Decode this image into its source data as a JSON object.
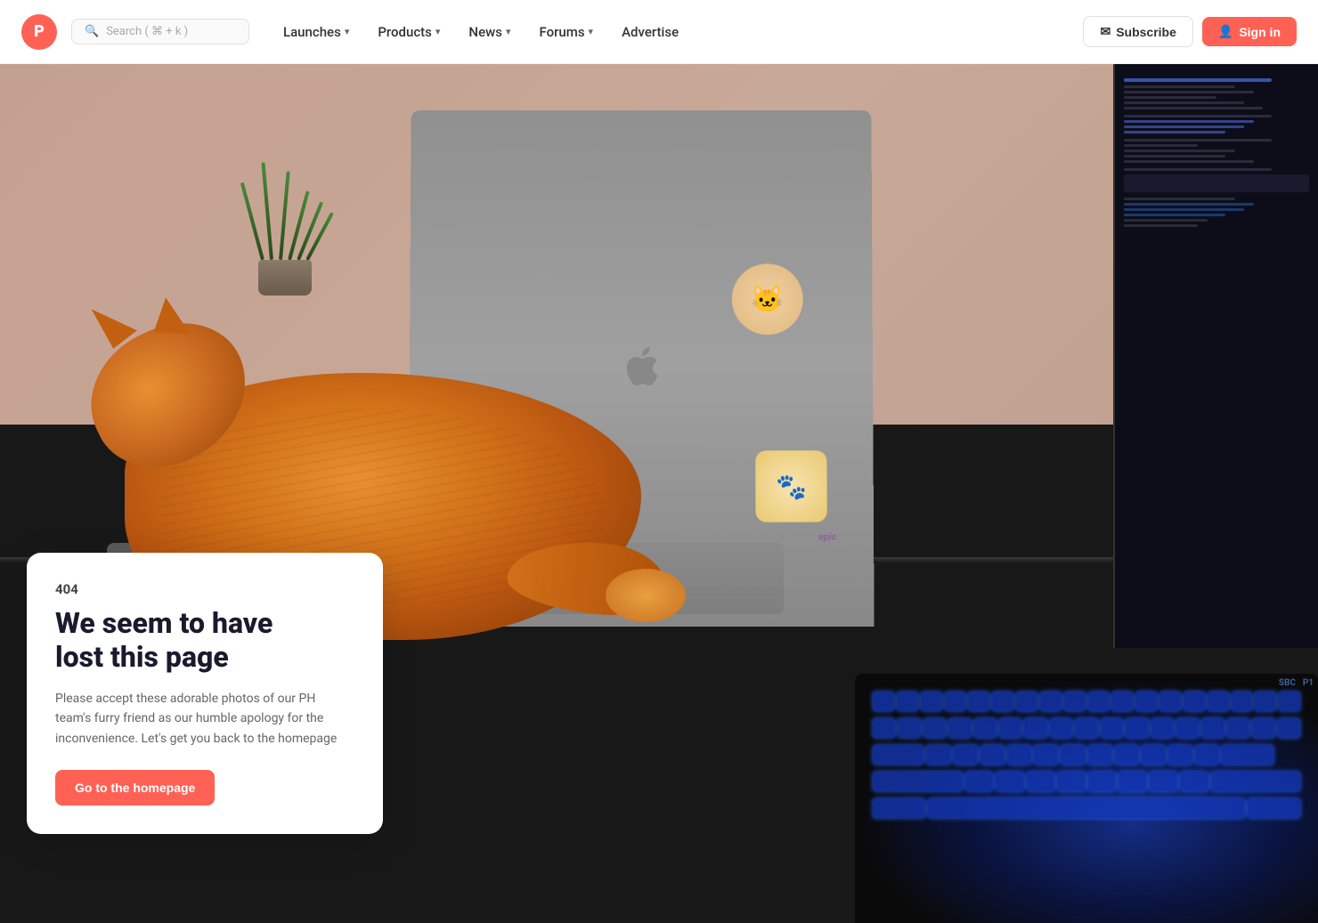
{
  "nav": {
    "logo_letter": "P",
    "search_placeholder": "Search ( ⌘ + k )",
    "links": [
      {
        "label": "Launches",
        "has_dropdown": true
      },
      {
        "label": "Products",
        "has_dropdown": true
      },
      {
        "label": "News",
        "has_dropdown": true
      },
      {
        "label": "Forums",
        "has_dropdown": true
      },
      {
        "label": "Advertise",
        "has_dropdown": false
      }
    ],
    "subscribe_label": "Subscribe",
    "signin_label": "Sign in"
  },
  "error_page": {
    "code": "404",
    "title_line1": "We seem to have",
    "title_line2": "lost this page",
    "description": "Please accept these adorable photos of our PH team's furry friend as our humble apology for the inconvenience. Let's get you back to the homepage",
    "button_label": "Go to the homepage"
  },
  "icons": {
    "search": "🔍",
    "envelope": "✉",
    "user": "👤",
    "chevron_down": "›",
    "logo_letter": "P"
  }
}
